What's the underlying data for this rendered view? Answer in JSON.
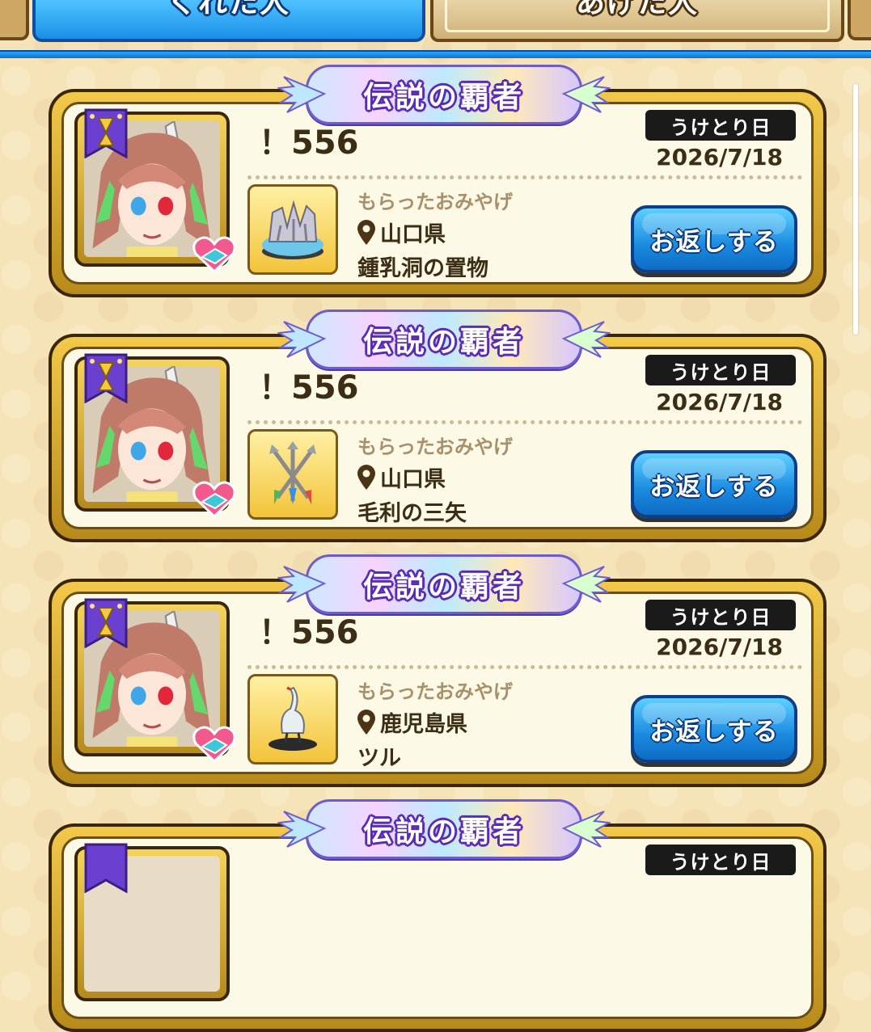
{
  "tabs": {
    "received_label": "くれた人",
    "given_label": "あげた人"
  },
  "cards": [
    {
      "banner_title": "伝説の覇者",
      "player_name": "！556",
      "date_label": "うけとり日",
      "date_value": "2026/7/18",
      "gift_label": "もらったおみやげ",
      "prefecture": "山口県",
      "item_name": "鍾乳洞の置物",
      "item_icon": "cave-ornament-icon",
      "button_label": "お返しする"
    },
    {
      "banner_title": "伝説の覇者",
      "player_name": "！556",
      "date_label": "うけとり日",
      "date_value": "2026/7/18",
      "gift_label": "もらったおみやげ",
      "prefecture": "山口県",
      "item_name": "毛利の三矢",
      "item_icon": "three-arrows-icon",
      "button_label": "お返しする"
    },
    {
      "banner_title": "伝説の覇者",
      "player_name": "！556",
      "date_label": "うけとり日",
      "date_value": "2026/7/18",
      "gift_label": "もらったおみやげ",
      "prefecture": "鹿児島県",
      "item_name": "ツル",
      "item_icon": "crane-figure-icon",
      "button_label": "お返しする"
    },
    {
      "banner_title": "伝説の覇者",
      "date_label": "うけとり日"
    }
  ],
  "colors": {
    "active_tab": "#1a8fe8",
    "card_frame": "#d9a92b",
    "card_inner": "#fdf9e7",
    "button": "#1a8ae0",
    "text": "#3c2e14",
    "muted_text": "#a8906a"
  }
}
